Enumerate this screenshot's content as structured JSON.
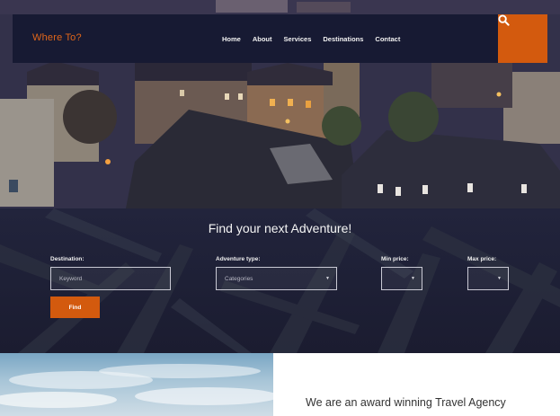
{
  "header": {
    "logo": "Where To?",
    "nav": [
      "Home",
      "About",
      "Services",
      "Destinations",
      "Contact"
    ]
  },
  "search": {
    "title": "Find your next Adventure!",
    "destination": {
      "label": "Destination:",
      "placeholder": "Keyword"
    },
    "adventure_type": {
      "label": "Adventure type:",
      "value": "Categories"
    },
    "min_price": {
      "label": "Min price:",
      "value": ""
    },
    "max_price": {
      "label": "Max price:",
      "value": ""
    },
    "button": "Find"
  },
  "about": {
    "tagline": "We are an award winning Travel Agency"
  },
  "icons": {
    "search": "search-icon",
    "select_arrow": "chevron-down-icon"
  },
  "colors": {
    "accent": "#d35a0e",
    "nav_bg": "#171a33",
    "band_bg": "#1e2036"
  }
}
